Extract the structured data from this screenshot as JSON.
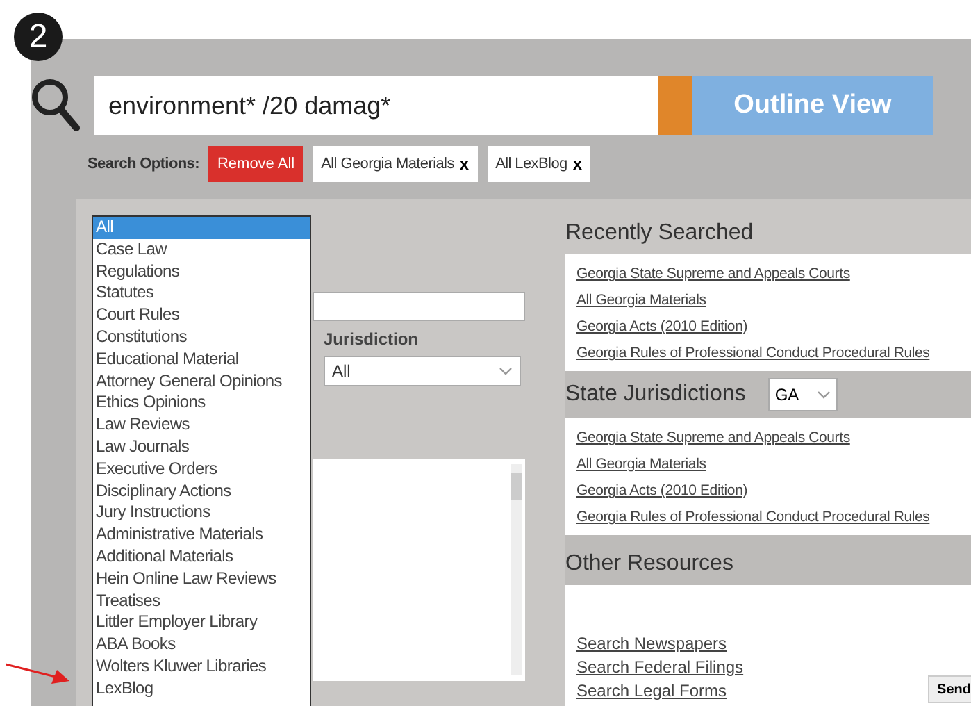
{
  "step_badge": "2",
  "search": {
    "query": "environment* /20 damag*",
    "outline_button": "Outline View"
  },
  "search_options": {
    "label": "Search Options:",
    "remove_all": "Remove All",
    "chips": [
      {
        "label": "All Georgia Materials",
        "remove": "x"
      },
      {
        "label": "All LexBlog",
        "remove": "x"
      }
    ]
  },
  "content_type_list": {
    "items": [
      {
        "label": "All",
        "selected": true
      },
      {
        "label": "Case Law",
        "selected": false
      },
      {
        "label": "Regulations",
        "selected": false
      },
      {
        "label": "Statutes",
        "selected": false
      },
      {
        "label": "Court Rules",
        "selected": false
      },
      {
        "label": "Constitutions",
        "selected": false
      },
      {
        "label": "Educational Material",
        "selected": false
      },
      {
        "label": "Attorney General Opinions",
        "selected": false
      },
      {
        "label": "Ethics Opinions",
        "selected": false
      },
      {
        "label": "Law Reviews",
        "selected": false
      },
      {
        "label": "Law Journals",
        "selected": false
      },
      {
        "label": "Executive Orders",
        "selected": false
      },
      {
        "label": "Disciplinary Actions",
        "selected": false
      },
      {
        "label": "Jury Instructions",
        "selected": false
      },
      {
        "label": "Administrative Materials",
        "selected": false
      },
      {
        "label": "Additional Materials",
        "selected": false
      },
      {
        "label": "Hein Online Law Reviews",
        "selected": false
      },
      {
        "label": "Treatises",
        "selected": false
      },
      {
        "label": "Littler Employer Library",
        "selected": false
      },
      {
        "label": "ABA Books",
        "selected": false
      },
      {
        "label": "Wolters Kluwer Libraries",
        "selected": false
      },
      {
        "label": "LexBlog",
        "selected": false
      }
    ]
  },
  "filters": {
    "jurisdiction_label": "Jurisdiction",
    "jurisdiction_value": "All"
  },
  "recently_searched": {
    "title": "Recently Searched",
    "links": [
      "Georgia State Supreme and Appeals Courts",
      "All Georgia Materials",
      "Georgia Acts (2010 Edition)",
      "Georgia Rules of Professional Conduct Procedural Rules"
    ]
  },
  "state_jurisdictions": {
    "title": "State Jurisdictions",
    "state": "GA",
    "links": [
      "Georgia State Supreme and Appeals Courts",
      "All Georgia Materials",
      "Georgia Acts (2010 Edition)",
      "Georgia Rules of Professional Conduct Procedural Rules"
    ]
  },
  "other_resources": {
    "title": "Other Resources",
    "links": [
      "Search Newspapers",
      "Search Federal Filings",
      "Search Legal Forms"
    ],
    "button": "Send"
  }
}
